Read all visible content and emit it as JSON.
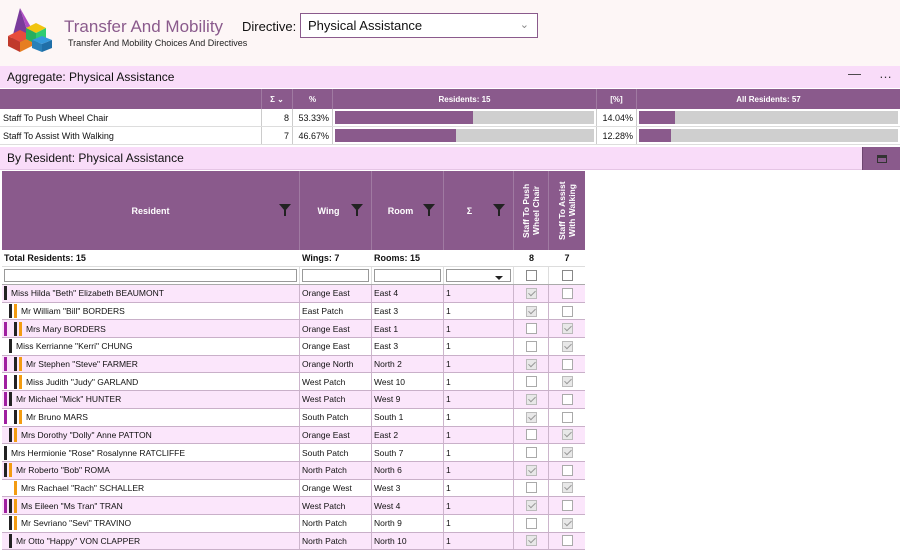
{
  "app": {
    "title": "Transfer And Mobility",
    "subtitle": "Transfer And Mobility Choices And Directives",
    "logo_icon": "colored-cubes-logo-icon"
  },
  "directive": {
    "label": "Directive:",
    "value": "Physical Assistance"
  },
  "aggregate": {
    "title": "Aggregate: Physical Assistance",
    "minimize_label": "—",
    "more_label": "…",
    "columns": {
      "sum": "Σ ⌄",
      "pct": "%",
      "residents": "Residents: 15",
      "all_pct": "[%]",
      "all_residents": "All Residents: 57"
    },
    "rows": [
      {
        "label": "Staff To Push Wheel Chair",
        "count": "8",
        "pct": "53.33%",
        "pct_value": 53.33,
        "all_pct": "14.04%",
        "all_pct_value": 14.04
      },
      {
        "label": "Staff To Assist With Walking",
        "count": "7",
        "pct": "46.67%",
        "pct_value": 46.67,
        "all_pct": "12.28%",
        "all_pct_value": 12.28
      }
    ]
  },
  "by_resident": {
    "title": "By Resident: Physical Assistance",
    "columns": {
      "resident": "Resident",
      "wing": "Wing",
      "room": "Room",
      "sum": "Σ",
      "push": "Staff To Push Wheel Chair",
      "walk": "Staff To Assist With Walking"
    },
    "totals": {
      "residents": "Total Residents: 15",
      "wings": "Wings: 7",
      "rooms": "Rooms: 15",
      "push": "8",
      "walk": "7"
    },
    "rows": [
      {
        "name": "Miss Hilda \"Beth\" Elizabeth BEAUMONT",
        "wing": "Orange East",
        "room": "East  4",
        "sum": "1",
        "push": true,
        "walk": false,
        "markers": [
          "b"
        ]
      },
      {
        "name": "Mr William \"Bill\" BORDERS",
        "wing": "East Patch",
        "room": "East  3",
        "sum": "1",
        "push": true,
        "walk": false,
        "markers": [
          "gap",
          "b",
          "o"
        ]
      },
      {
        "name": "Mrs Mary BORDERS",
        "wing": "Orange East",
        "room": "East  1",
        "sum": "1",
        "push": false,
        "walk": true,
        "markers": [
          "p",
          "gap",
          "b",
          "o"
        ]
      },
      {
        "name": "Miss Kerrianne \"Kerri\" CHUNG",
        "wing": "Orange East",
        "room": "East  3",
        "sum": "1",
        "push": false,
        "walk": true,
        "markers": [
          "gap",
          "b"
        ]
      },
      {
        "name": "Mr Stephen \"Steve\" FARMER",
        "wing": "Orange North",
        "room": "North  2",
        "sum": "1",
        "push": true,
        "walk": false,
        "markers": [
          "p",
          "gap",
          "b",
          "o"
        ]
      },
      {
        "name": "Miss Judith \"Judy\" GARLAND",
        "wing": "West Patch",
        "room": "West 10",
        "sum": "1",
        "push": false,
        "walk": true,
        "markers": [
          "p",
          "gap",
          "b",
          "o"
        ]
      },
      {
        "name": "Mr Michael \"Mick\" HUNTER",
        "wing": "West Patch",
        "room": "West  9",
        "sum": "1",
        "push": true,
        "walk": false,
        "markers": [
          "p",
          "b"
        ]
      },
      {
        "name": "Mr Bruno MARS",
        "wing": "South Patch",
        "room": "South  1",
        "sum": "1",
        "push": true,
        "walk": false,
        "markers": [
          "p",
          "gap",
          "b",
          "o"
        ]
      },
      {
        "name": "Mrs Dorothy \"Dolly\" Anne PATTON",
        "wing": "Orange East",
        "room": "East  2",
        "sum": "1",
        "push": false,
        "walk": true,
        "markers": [
          "gap",
          "b",
          "o"
        ]
      },
      {
        "name": "Mrs Hermionie \"Rose\" Rosalynne RATCLIFFE",
        "wing": "South Patch",
        "room": "South  7",
        "sum": "1",
        "push": false,
        "walk": true,
        "markers": [
          "b"
        ]
      },
      {
        "name": "Mr Roberto \"Bob\" ROMA",
        "wing": "North Patch",
        "room": "North  6",
        "sum": "1",
        "push": true,
        "walk": false,
        "markers": [
          "b",
          "o"
        ]
      },
      {
        "name": "Mrs Rachael \"Rach\" SCHALLER",
        "wing": "Orange West",
        "room": "West  3",
        "sum": "1",
        "push": false,
        "walk": true,
        "markers": [
          "gap",
          "gap",
          "o"
        ]
      },
      {
        "name": "Ms Eileen \"Ms Tran\" TRAN",
        "wing": "West Patch",
        "room": "West  4",
        "sum": "1",
        "push": true,
        "walk": false,
        "markers": [
          "p",
          "b",
          "o"
        ]
      },
      {
        "name": "Mr Sevriano \"Sevi\" TRAVINO",
        "wing": "North Patch",
        "room": "North  9",
        "sum": "1",
        "push": false,
        "walk": true,
        "markers": [
          "gap",
          "b",
          "o"
        ]
      },
      {
        "name": "Mr  Otto \"Happy\" VON CLAPPER",
        "wing": "North Patch",
        "room": "North  10",
        "sum": "1",
        "push": true,
        "walk": false,
        "markers": [
          "gap",
          "b"
        ]
      }
    ]
  }
}
